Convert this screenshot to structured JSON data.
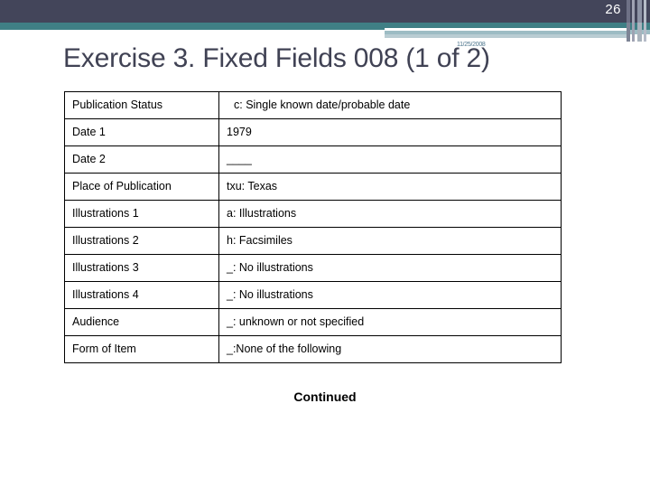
{
  "header": {
    "page_number": "26",
    "date_stamp": "11/25/2008",
    "colors": {
      "navy": "#43455a",
      "teal": "#3f7f85",
      "light_blue": "#9dbcc4",
      "pale_blue": "#b9ccd2"
    }
  },
  "title": "Exercise 3. Fixed Fields 008 (1 of 2)",
  "table": {
    "rows": [
      {
        "label": "Publication Status",
        "value": "c: Single known date/probable date"
      },
      {
        "label": "Date 1",
        "value": "1979"
      },
      {
        "label": "Date 2",
        "value": "____"
      },
      {
        "label": "Place of Publication",
        "value": "txu: Texas"
      },
      {
        "label": "Illustrations 1",
        "value": "a: Illustrations"
      },
      {
        "label": "Illustrations 2",
        "value": "h: Facsimiles"
      },
      {
        "label": "Illustrations 3",
        "value": "_: No illustrations"
      },
      {
        "label": "Illustrations  4",
        "value": "_: No illustrations"
      },
      {
        "label": "Audience",
        "value": "_: unknown or not specified"
      },
      {
        "label": "Form of Item",
        "value": "_:None of the following"
      }
    ]
  },
  "footer": {
    "continued_label": "Continued"
  }
}
